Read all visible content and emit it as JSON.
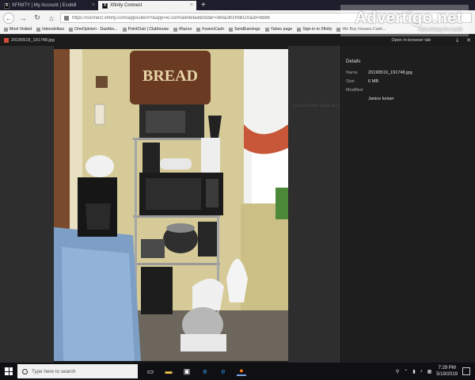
{
  "browser": {
    "tabs": [
      {
        "title": "XFINITY | My Account | Ecobill",
        "active": false
      },
      {
        "title": "Xfinity Connect",
        "active": true
      }
    ],
    "url": "https://connect.xfinity.com/appsuite/#!!&app=io.ox/mail/detail&folder=default0/INBOX&id=8686",
    "bookmarks": [
      "Most Visited",
      "Inboxdollars",
      "OneOpinion - Dashbo...",
      "PointClub | Clubhouse",
      "iRazoo",
      "FusionCash",
      "SendEarnings",
      "Yahoo page",
      "Sign in to Xfinity",
      "We Buy Houses Cash..."
    ]
  },
  "viewer": {
    "filename": "20190519_191748.jpg",
    "open_in_tab": "Open in browser tab",
    "ghost_links": "Save to Drive    Send as mail    Delete"
  },
  "details": {
    "title": "Details",
    "rows": [
      {
        "label": "Name",
        "value": "20190519_191748.jpg"
      },
      {
        "label": "Size",
        "value": "6 MB"
      },
      {
        "label": "Modified",
        "value": ""
      },
      {
        "label": "",
        "value": "Janice keiser"
      }
    ]
  },
  "photo": {
    "bread_box_text": "BREAD"
  },
  "watermark": {
    "main": "Advertigo.net",
    "sub": "Advertising the world"
  },
  "taskbar": {
    "search_placeholder": "Type here to search",
    "time": "7:29 PM",
    "date": "5/19/2019"
  },
  "colors": {
    "viewer_bg": "#1b1b1b",
    "stage_bg": "#2e2e2e",
    "taskbar_bg": "#101014",
    "accent": "#7aa6e8"
  }
}
